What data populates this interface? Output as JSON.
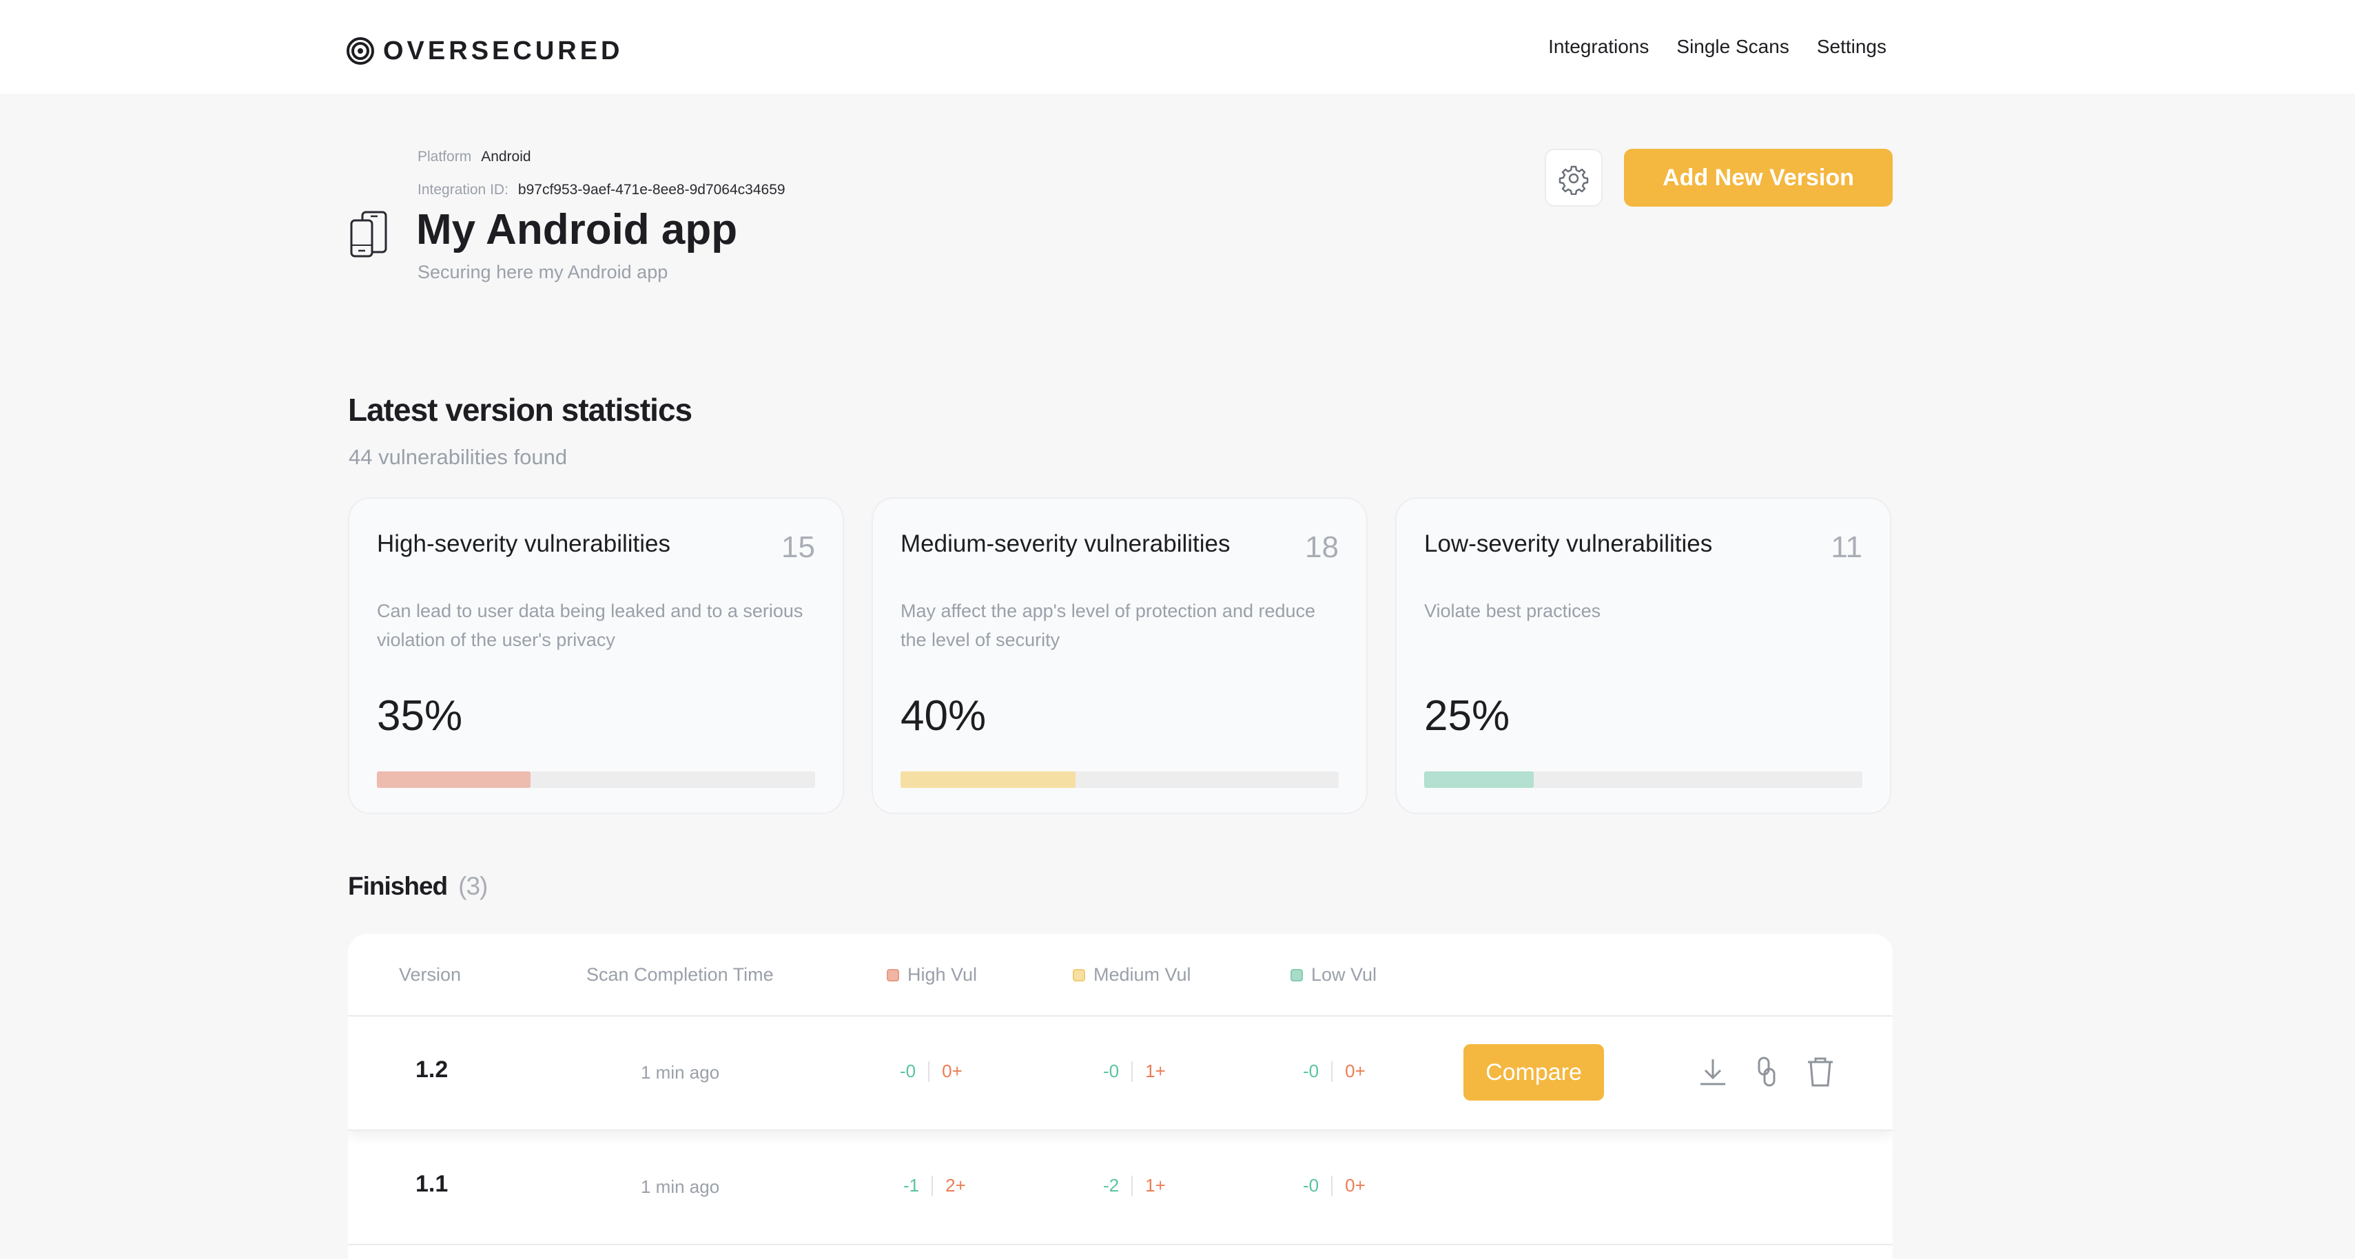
{
  "brand": {
    "name": "OVERSECURED"
  },
  "nav": [
    "Integrations",
    "Single Scans",
    "Settings"
  ],
  "app": {
    "platform_label": "Platform",
    "platform_value": "Android",
    "integration_label": "Integration ID:",
    "integration_value": "b97cf953-9aef-471e-8ee8-9d7064c34659",
    "title": "My Android app",
    "subtitle": "Securing here my Android app",
    "add_version_label": "Add New Version"
  },
  "stats": {
    "title": "Latest version statistics",
    "subtitle": "44 vulnerabilities found",
    "cards": [
      {
        "title": "High-severity vulnerabilities",
        "count": "15",
        "desc": "Can lead to user data being leaked and to a serious violation of the user's privacy",
        "pct": "35%",
        "fraction": 0.35,
        "color": "#edbcae"
      },
      {
        "title": "Medium-severity vulnerabilities",
        "count": "18",
        "desc": "May affect the app's level of protection and reduce the level of security",
        "pct": "40%",
        "fraction": 0.4,
        "color": "#f6dfa2"
      },
      {
        "title": "Low-severity vulnerabilities",
        "count": "11",
        "desc": "Violate best practices",
        "pct": "25%",
        "fraction": 0.25,
        "color": "#b3e0d0"
      }
    ]
  },
  "finished": {
    "title": "Finished",
    "count": "(3)",
    "headers": {
      "version": "Version",
      "time": "Scan Completion Time",
      "high": "High Vul",
      "medium": "Medium Vul",
      "low": "Low Vul"
    },
    "legend_colors": {
      "high": "#f1b5a4",
      "medium": "#f7e0a0",
      "low": "#a9dcc8"
    },
    "rows": [
      {
        "version": "1.2",
        "time": "1 min ago",
        "high_neg": "-0",
        "high_pos": "0+",
        "med_neg": "-0",
        "med_pos": "1+",
        "low_neg": "-0",
        "low_pos": "0+",
        "compare_label": "Compare"
      },
      {
        "version": "1.1",
        "time": "1 min ago",
        "high_neg": "-1",
        "high_pos": "2+",
        "med_neg": "-2",
        "med_pos": "1+",
        "low_neg": "-0",
        "low_pos": "0+"
      }
    ]
  }
}
